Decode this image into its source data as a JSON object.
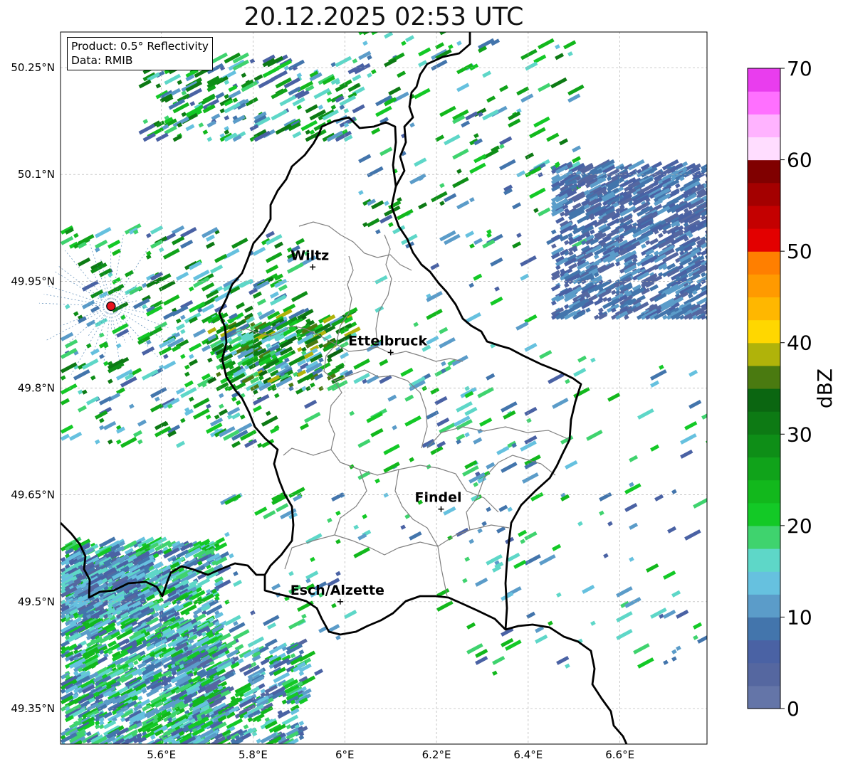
{
  "title": "20.12.2025 02:53 UTC",
  "info": {
    "product": "Product: 0.5° Reflectivity",
    "data": "Data: RMIB"
  },
  "map": {
    "lon_range": [
      5.38,
      6.79
    ],
    "lat_range": [
      49.3,
      50.3
    ],
    "lon_ticks": [
      {
        "value": 5.6,
        "label": "5.6°E"
      },
      {
        "value": 5.8,
        "label": "5.8°E"
      },
      {
        "value": 6.0,
        "label": "6°E"
      },
      {
        "value": 6.2,
        "label": "6.2°E"
      },
      {
        "value": 6.4,
        "label": "6.4°E"
      },
      {
        "value": 6.6,
        "label": "6.6°E"
      }
    ],
    "lat_ticks": [
      {
        "value": 49.35,
        "label": "49.35°N"
      },
      {
        "value": 49.5,
        "label": "49.5°N"
      },
      {
        "value": 49.65,
        "label": "49.65°N"
      },
      {
        "value": 49.8,
        "label": "49.8°N"
      },
      {
        "value": 49.95,
        "label": "49.95°N"
      },
      {
        "value": 50.1,
        "label": "50.1°N"
      },
      {
        "value": 50.25,
        "label": "50.25°N"
      }
    ],
    "cities": [
      {
        "name": "Wiltz",
        "lon": 5.93,
        "lat": 49.97
      },
      {
        "name": "Ettelbruck",
        "lon": 6.1,
        "lat": 49.85
      },
      {
        "name": "Findel",
        "lon": 6.21,
        "lat": 49.63
      },
      {
        "name": "Esch/Alzette",
        "lon": 5.99,
        "lat": 49.5
      }
    ],
    "radar_site": {
      "lon": 5.49,
      "lat": 49.915,
      "color": "#e8141e"
    },
    "border_color": "#000000",
    "canton_color": "#808080",
    "grid": true
  },
  "colorbar": {
    "label": "dBZ",
    "min": 0,
    "max": 70,
    "ticks": [
      {
        "value": 0,
        "label": "0"
      },
      {
        "value": 10,
        "label": "10"
      },
      {
        "value": 20,
        "label": "20"
      },
      {
        "value": 30,
        "label": "30"
      },
      {
        "value": 40,
        "label": "40"
      },
      {
        "value": 50,
        "label": "50"
      },
      {
        "value": 60,
        "label": "60"
      },
      {
        "value": 70,
        "label": "70"
      }
    ],
    "colors": [
      "#6475a8",
      "#5567a0",
      "#4a62a4",
      "#4375ac",
      "#5b9cc9",
      "#66c1df",
      "#5ed7c8",
      "#3fd36e",
      "#13c926",
      "#12b81c",
      "#10a31a",
      "#0e8e17",
      "#0d7a14",
      "#0b6611",
      "#4a7a10",
      "#b0b30a",
      "#ffd700",
      "#ffb700",
      "#ff9a00",
      "#ff7f00",
      "#e30000",
      "#c40000",
      "#a40000",
      "#800000",
      "#ffddff",
      "#ffb3ff",
      "#ff70ff",
      "#e93dee"
    ]
  },
  "echo_regions": [
    {
      "lon": [
        5.38,
        5.72
      ],
      "lat": [
        49.3,
        49.58
      ],
      "density": 0.55,
      "levels": [
        2,
        9
      ]
    },
    {
      "lon": [
        5.38,
        5.55
      ],
      "lat": [
        49.48,
        49.56
      ],
      "density": 0.75,
      "levels": [
        1,
        6
      ]
    },
    {
      "lon": [
        5.62,
        5.9
      ],
      "lat": [
        49.3,
        49.44
      ],
      "density": 0.3,
      "levels": [
        1,
        9
      ]
    },
    {
      "lon": [
        5.38,
        5.92
      ],
      "lat": [
        49.72,
        50.02
      ],
      "density": 0.1,
      "levels": [
        2,
        12
      ]
    },
    {
      "lon": [
        5.7,
        6.0
      ],
      "lat": [
        49.8,
        49.9
      ],
      "density": 0.3,
      "levels": [
        3,
        15
      ]
    },
    {
      "lon": [
        5.55,
        6.02
      ],
      "lat": [
        50.15,
        50.26
      ],
      "density": 0.18,
      "levels": [
        2,
        12
      ]
    },
    {
      "lon": [
        6.02,
        6.5
      ],
      "lat": [
        50.0,
        50.3
      ],
      "density": 0.05,
      "levels": [
        2,
        12
      ]
    },
    {
      "lon": [
        6.0,
        6.4
      ],
      "lat": [
        49.55,
        49.98
      ],
      "density": 0.025,
      "levels": [
        2,
        9
      ]
    },
    {
      "lon": [
        6.45,
        6.79
      ],
      "lat": [
        49.9,
        50.11
      ],
      "density": 0.45,
      "levels": [
        1,
        4
      ]
    },
    {
      "lon": [
        6.2,
        6.79
      ],
      "lat": [
        49.4,
        49.85
      ],
      "density": 0.02,
      "levels": [
        2,
        9
      ]
    },
    {
      "lon": [
        5.7,
        6.0
      ],
      "lat": [
        49.4,
        49.65
      ],
      "density": 0.04,
      "levels": [
        2,
        9
      ]
    }
  ]
}
